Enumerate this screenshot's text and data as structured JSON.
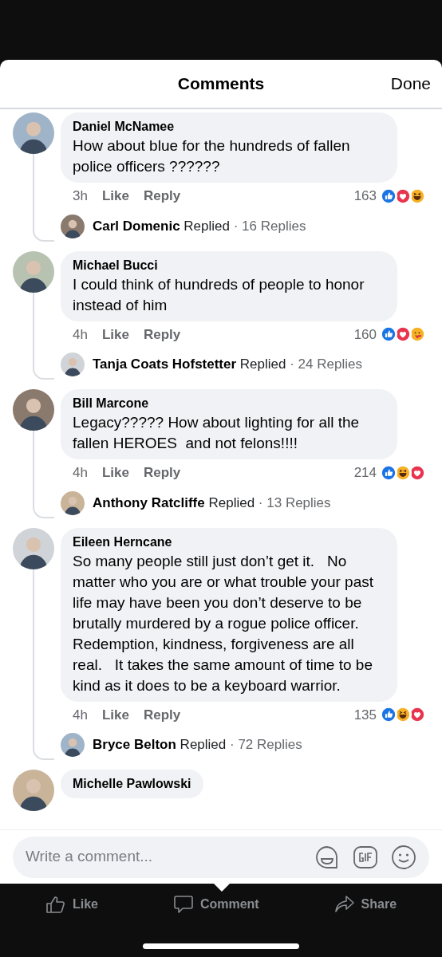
{
  "header": {
    "title": "Comments",
    "done": "Done"
  },
  "comments": [
    {
      "author": "Daniel McNamee",
      "text": "How about blue for the hundreds of fallen police officers ??????",
      "time": "3h",
      "like": "Like",
      "reply": "Reply",
      "count": "163",
      "reactions": [
        {
          "kind": "like"
        },
        {
          "kind": "love"
        },
        {
          "kind": "haha"
        }
      ],
      "replies": {
        "author": "Carl Domenic",
        "verb": "Replied",
        "count": "· 16 Replies"
      }
    },
    {
      "author": "Michael Bucci",
      "text": "I could think of hundreds of people to honor instead of him",
      "time": "4h",
      "like": "Like",
      "reply": "Reply",
      "count": "160",
      "reactions": [
        {
          "kind": "like"
        },
        {
          "kind": "love"
        },
        {
          "kind": "care"
        }
      ],
      "replies": {
        "author": "Tanja Coats Hofstetter",
        "verb": "Replied",
        "count": "· 24 Replies"
      }
    },
    {
      "author": "Bill Marcone",
      "text": "Legacy????? How about lighting for all the fallen HEROES  and not felons!!!!",
      "time": "4h",
      "like": "Like",
      "reply": "Reply",
      "count": "214",
      "reactions": [
        {
          "kind": "like"
        },
        {
          "kind": "haha"
        },
        {
          "kind": "love"
        }
      ],
      "replies": {
        "author": "Anthony Ratcliffe",
        "verb": "Replied",
        "count": "· 13 Replies"
      }
    },
    {
      "author": "Eileen Herncane",
      "text": "So many people still just don’t get it.   No matter who you are or what trouble your past life may have been you don’t deserve to be brutally murdered by a rogue police officer. Redemption, kindness, forgiveness are all real.   It takes the same amount of time to be kind as it does to be a keyboard warrior.",
      "time": "4h",
      "like": "Like",
      "reply": "Reply",
      "count": "135",
      "reactions": [
        {
          "kind": "like"
        },
        {
          "kind": "haha"
        },
        {
          "kind": "love"
        }
      ],
      "replies": {
        "author": "Bryce Belton",
        "verb": "Replied",
        "count": "· 72 Replies"
      }
    },
    {
      "author": "Michelle Pawlowski"
    }
  ],
  "composer": {
    "placeholder": "Write a comment..."
  },
  "actions": [
    {
      "kind": "like",
      "label": "Like"
    },
    {
      "kind": "comment",
      "label": "Comment"
    },
    {
      "kind": "share",
      "label": "Share"
    }
  ]
}
